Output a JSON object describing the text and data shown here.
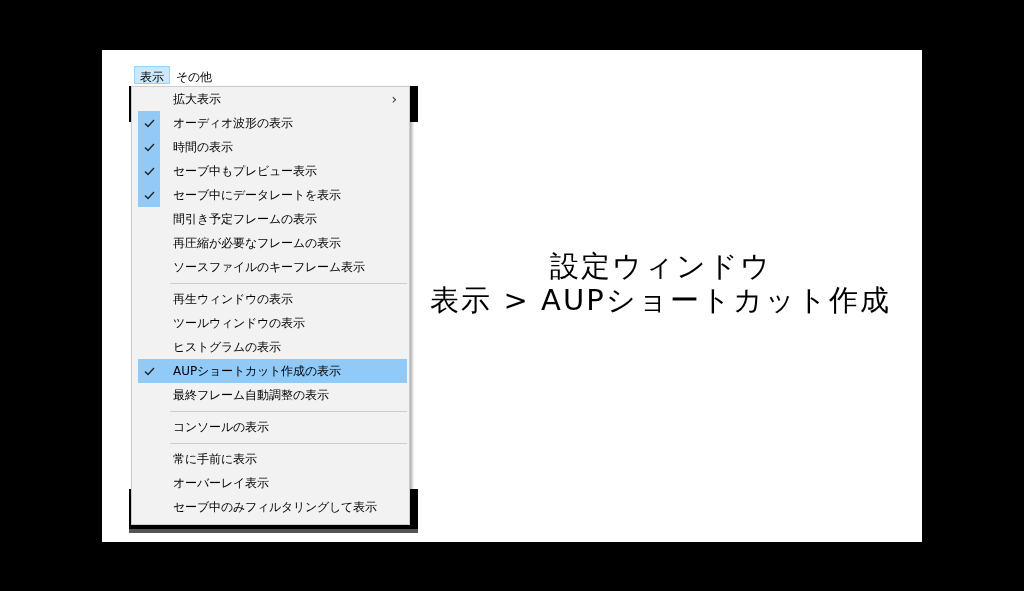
{
  "menubar": [
    {
      "label": "表示",
      "selected": true
    },
    {
      "label": "その他",
      "selected": false
    }
  ],
  "menu": [
    {
      "kind": "submenu",
      "label": "拡大表示",
      "arrow": "›",
      "checked": false,
      "selected": false
    },
    {
      "kind": "item",
      "label": "オーディオ波形の表示",
      "checked": true,
      "selected": false
    },
    {
      "kind": "item",
      "label": "時間の表示",
      "checked": true,
      "selected": false
    },
    {
      "kind": "item",
      "label": "セーブ中もプレビュー表示",
      "checked": true,
      "selected": false
    },
    {
      "kind": "item",
      "label": "セーブ中にデータレートを表示",
      "checked": true,
      "selected": false
    },
    {
      "kind": "item",
      "label": "間引き予定フレームの表示",
      "checked": false,
      "selected": false
    },
    {
      "kind": "item",
      "label": "再圧縮が必要なフレームの表示",
      "checked": false,
      "selected": false
    },
    {
      "kind": "item",
      "label": "ソースファイルのキーフレーム表示",
      "checked": false,
      "selected": false
    },
    {
      "kind": "separator"
    },
    {
      "kind": "item",
      "label": "再生ウィンドウの表示",
      "checked": false,
      "selected": false
    },
    {
      "kind": "item",
      "label": "ツールウィンドウの表示",
      "checked": false,
      "selected": false
    },
    {
      "kind": "item",
      "label": "ヒストグラムの表示",
      "checked": false,
      "selected": false
    },
    {
      "kind": "item",
      "label": "AUPショートカット作成の表示",
      "checked": true,
      "selected": true
    },
    {
      "kind": "item",
      "label": "最終フレーム自動調整の表示",
      "checked": false,
      "selected": false
    },
    {
      "kind": "separator"
    },
    {
      "kind": "item",
      "label": "コンソールの表示",
      "checked": false,
      "selected": false
    },
    {
      "kind": "separator"
    },
    {
      "kind": "item",
      "label": "常に手前に表示",
      "checked": false,
      "selected": false
    },
    {
      "kind": "item",
      "label": "オーバーレイ表示",
      "checked": false,
      "selected": false
    },
    {
      "kind": "item",
      "label": "セーブ中のみフィルタリングして表示",
      "checked": false,
      "selected": false
    }
  ],
  "caption": [
    "設定ウィンドウ",
    "表示 > AUPショートカット作成"
  ]
}
